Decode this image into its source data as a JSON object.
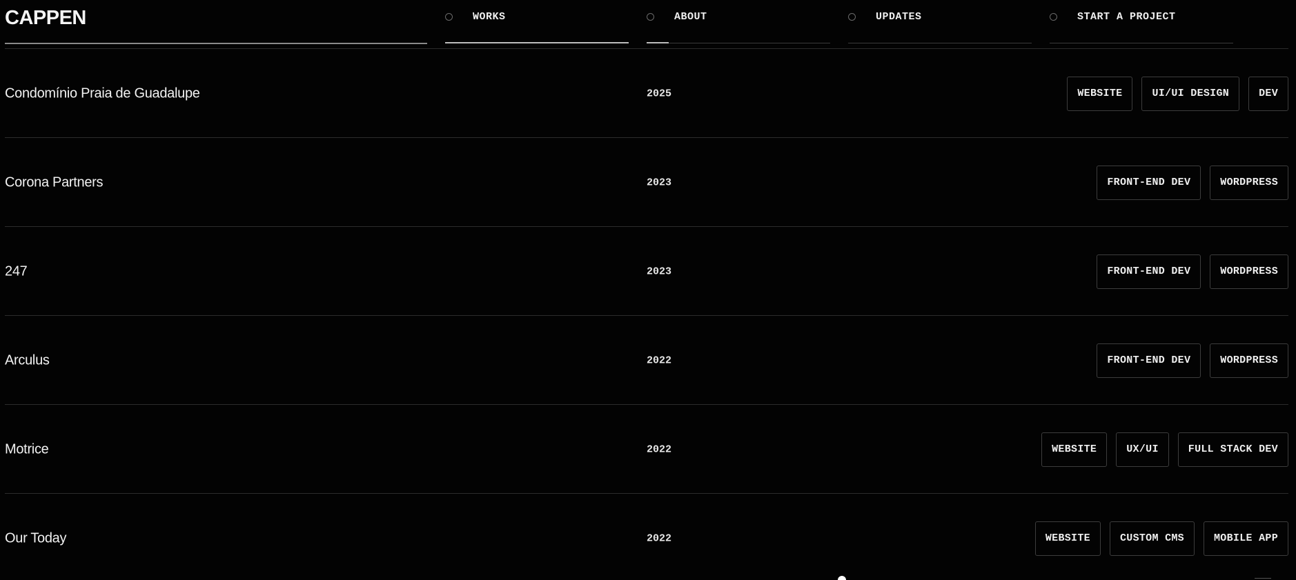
{
  "brand": {
    "logo_text": "CAPPEN"
  },
  "nav": {
    "items": [
      {
        "label": "WORKS",
        "progress": 1.0
      },
      {
        "label": "ABOUT",
        "progress": 0.12
      },
      {
        "label": "UPDATES",
        "progress": 0
      },
      {
        "label": "START A PROJECT",
        "progress": 0
      }
    ]
  },
  "works": [
    {
      "title": "Condomínio Praia de Guadalupe",
      "year": "2025",
      "tags": [
        "WEBSITE",
        "UI/UI DESIGN",
        "DEV"
      ]
    },
    {
      "title": "Corona Partners",
      "year": "2023",
      "tags": [
        "FRONT-END DEV",
        "WORDPRESS"
      ]
    },
    {
      "title": "247",
      "year": "2023",
      "tags": [
        "FRONT-END DEV",
        "WORDPRESS"
      ]
    },
    {
      "title": "Arculus",
      "year": "2022",
      "tags": [
        "FRONT-END DEV",
        "WORDPRESS"
      ]
    },
    {
      "title": "Motrice",
      "year": "2022",
      "tags": [
        "WEBSITE",
        "UX/UI",
        "FULL STACK DEV"
      ]
    },
    {
      "title": "Our Today",
      "year": "2022",
      "tags": [
        "WEBSITE",
        "CUSTOM CMS",
        "MOBILE APP"
      ]
    }
  ],
  "colors": {
    "background": "#030303",
    "text": "#f2f2f2",
    "rule": "#2c2c2c",
    "tag_border": "#3d3d3d",
    "nav_progress": "#bdbdbd"
  }
}
